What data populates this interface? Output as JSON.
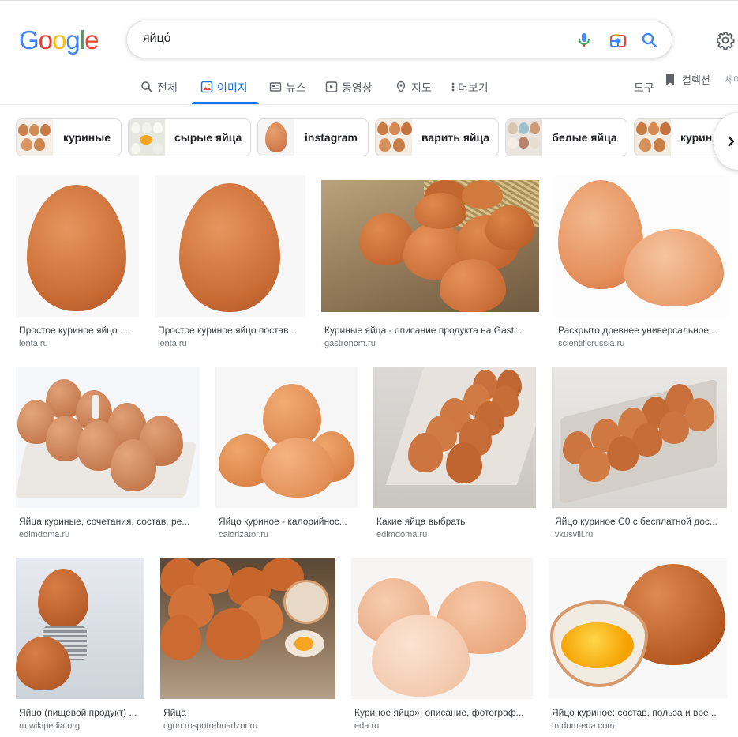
{
  "search": {
    "query": "яйцо́"
  },
  "logo": {
    "letters": [
      "G",
      "o",
      "o",
      "g",
      "l",
      "e"
    ],
    "colors": [
      "#4285f4",
      "#ea4335",
      "#fbbc05",
      "#4285f4",
      "#34a853",
      "#ea4335"
    ]
  },
  "tabs": [
    {
      "label": "전체",
      "icon": "search-icon"
    },
    {
      "label": "이미지",
      "icon": "image-icon",
      "active": true
    },
    {
      "label": "뉴스",
      "icon": "news-icon"
    },
    {
      "label": "동영상",
      "icon": "video-icon"
    },
    {
      "label": "지도",
      "icon": "location-pin-icon"
    },
    {
      "label": "더보기",
      "icon": "more-dots-icon"
    }
  ],
  "header": {
    "tools": "도구",
    "collections": "컬렉션",
    "safe_search": "세이"
  },
  "chips": [
    {
      "label": "куриные"
    },
    {
      "label": "сырые яйца"
    },
    {
      "label": "instagram"
    },
    {
      "label": "варить яйца"
    },
    {
      "label": "белые яйца"
    },
    {
      "label": "курин"
    }
  ],
  "results": [
    {
      "title": "Простое куриное яйцо ...",
      "source": "lenta.ru"
    },
    {
      "title": "Простое куриное яйцо постав...",
      "source": "lenta.ru"
    },
    {
      "title": "Куриные яйца - описание продукта на Gastr...",
      "source": "gastronom.ru"
    },
    {
      "title": "Раскрыто древнее универсальное...",
      "source": "scientificrussia.ru"
    },
    {
      "title": "Яйца куриные, сочетания, состав, ре...",
      "source": "edimdoma.ru"
    },
    {
      "title": "Яйцо куриное - калорийнос...",
      "source": "calorizator.ru"
    },
    {
      "title": "Какие яйца выбрать",
      "source": "edimdoma.ru"
    },
    {
      "title": "Яйцо куриное С0 с бесплатной дос...",
      "source": "vkusvill.ru"
    },
    {
      "title": "Яйцо (пищевой продукт) ...",
      "source": "ru.wikipedia.org"
    },
    {
      "title": "Яйца",
      "source": "cgon.rospotrebnadzor.ru"
    },
    {
      "title": "Куриное яйцо», описание, фотограф...",
      "source": "eda.ru"
    },
    {
      "title": "Яйцо куриное: состав, польза и вре...",
      "source": "m.dom-eda.com"
    }
  ],
  "colors": {
    "accent": "#1a73e8",
    "egg": "#d88a55",
    "egg_light": "#f0b890"
  }
}
